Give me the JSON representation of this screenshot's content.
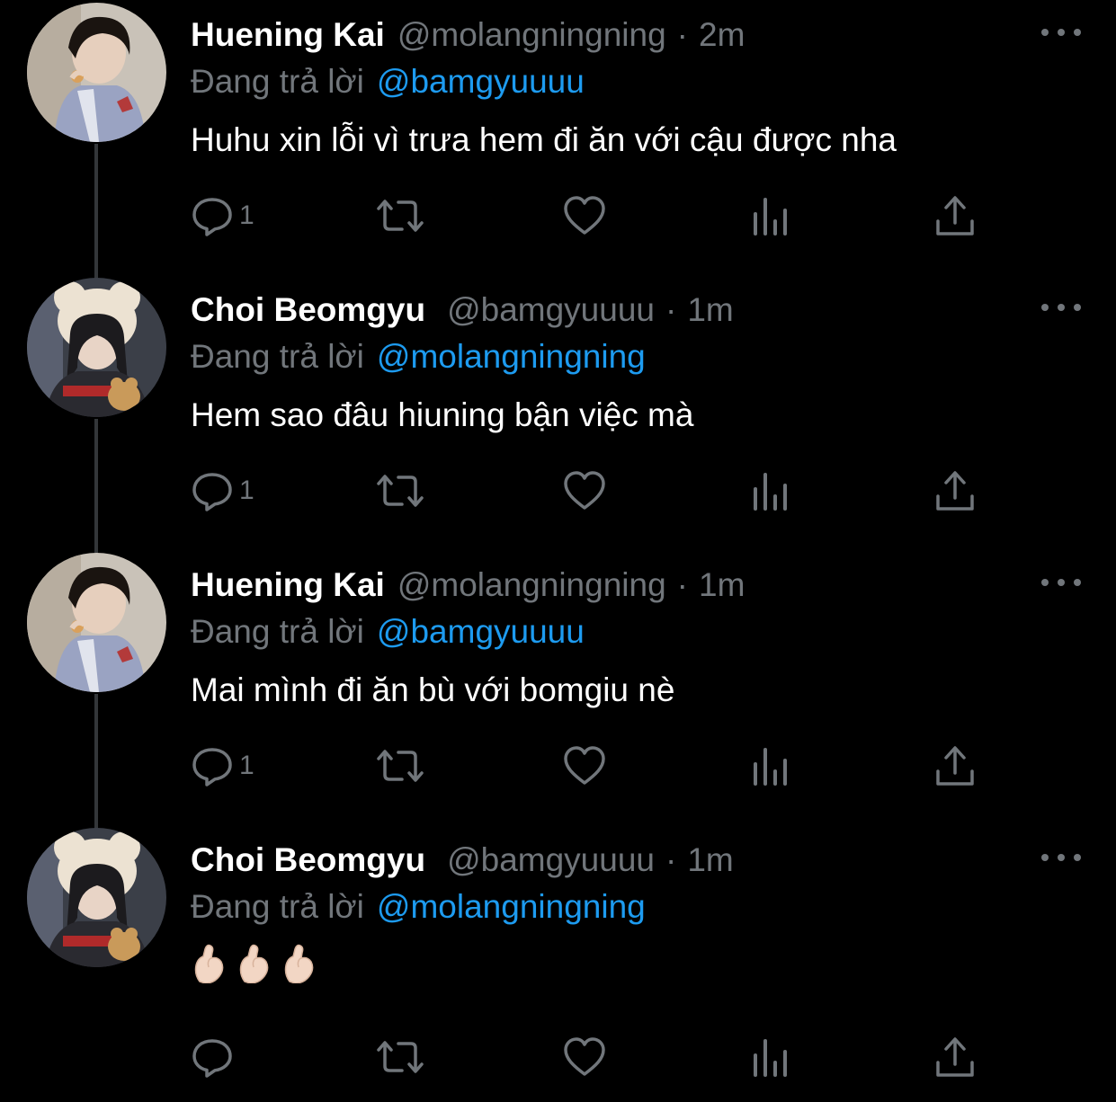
{
  "colors": {
    "background": "#000000",
    "name": "#ffffff",
    "muted": "#71767b",
    "mention": "#1d9bf0",
    "thread_line": "#333639"
  },
  "reply_prefix": "Đang trả lời",
  "tweets": [
    {
      "name": "Huening Kai",
      "handle": "@molangningning",
      "separator": "·",
      "time": "2m",
      "reply_to": "@bamgyuuuu",
      "text": "Huhu xin lỗi vì trưa hem đi ăn với cậu được nha",
      "reply_count": "1",
      "avatar_icon": "profile-photo-huening-kai"
    },
    {
      "name": "Choi Beomgyu",
      "handle": "@bamgyuuuu",
      "separator": "·",
      "time": "1m",
      "reply_to": "@molangningning",
      "text": "Hem sao đâu hiuning bận việc mà",
      "reply_count": "1",
      "avatar_icon": "profile-photo-choi-beomgyu"
    },
    {
      "name": "Huening Kai",
      "handle": "@molangningning",
      "separator": "·",
      "time": "1m",
      "reply_to": "@bamgyuuuu",
      "text": "Mai mình đi ăn bù với bomgiu nè",
      "reply_count": "1",
      "avatar_icon": "profile-photo-huening-kai"
    },
    {
      "name": "Choi Beomgyu",
      "handle": "@bamgyuuuu",
      "separator": "·",
      "time": "1m",
      "reply_to": "@molangningning",
      "text": "🫰🏻🫰🏻🫰🏻",
      "reply_count": "",
      "avatar_icon": "profile-photo-choi-beomgyu"
    }
  ],
  "icons": {
    "more": "more-horizontal-icon",
    "reply": "reply-bubble-icon",
    "retweet": "retweet-icon",
    "like": "heart-icon",
    "views": "views-bar-chart-icon",
    "share": "share-upload-icon",
    "emoji": "finger-heart-emoji-icon"
  }
}
